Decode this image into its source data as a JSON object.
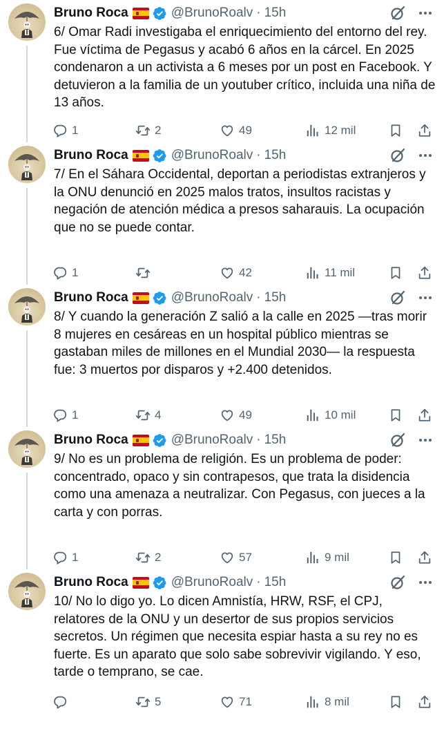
{
  "colors": {
    "text": "#0f1419",
    "secondary": "#536471",
    "verified": "#1d9bf0",
    "thread_line": "#cfd9de"
  },
  "icons": {
    "verified": "verified-badge-icon",
    "grok": "grok-icon",
    "more": "more-icon",
    "reply": "reply-icon",
    "repost": "repost-icon",
    "like": "like-icon",
    "views": "views-icon",
    "bookmark": "bookmark-icon",
    "share": "share-icon"
  },
  "tweets": [
    {
      "author_name": "Bruno Roca",
      "handle": "@BrunoRoalv",
      "dot": "·",
      "time": "15h",
      "text": "6/ Omar Radi investigaba el enriquecimiento del entorno del rey. Fue víctima de Pegasus y acabó 6 años en la cárcel. En 2025 condenaron a un activista a 6 meses por un post en Facebook. Y detuvieron a la familia de un youtuber crítico, incluida una niña de 13 años.",
      "replies": "1",
      "reposts": "2",
      "likes": "49",
      "views": "12 mil"
    },
    {
      "author_name": "Bruno Roca",
      "handle": "@BrunoRoalv",
      "dot": "·",
      "time": "15h",
      "text": "7/ En el Sáhara Occidental, deportan a periodistas extranjeros y la ONU denunció en 2025 malos tratos, insultos racistas y negación de atención médica a presos saharauis. La ocupación que no se puede contar.",
      "replies": "1",
      "reposts": "",
      "likes": "42",
      "views": "11 mil"
    },
    {
      "author_name": "Bruno Roca",
      "handle": "@BrunoRoalv",
      "dot": "·",
      "time": "15h",
      "text": "8/ Y cuando la generación Z salió a la calle en 2025 —tras morir 8 mujeres en cesáreas en un hospital público mientras se gastaban miles de millones en el Mundial 2030— la respuesta fue: 3 muertos por disparos y +2.400 detenidos.",
      "replies": "1",
      "reposts": "4",
      "likes": "49",
      "views": "10 mil"
    },
    {
      "author_name": "Bruno Roca",
      "handle": "@BrunoRoalv",
      "dot": "·",
      "time": "15h",
      "text": "9/ No es un problema de religión. Es un problema de poder: concentrado, opaco y sin contrapesos, que trata la disidencia como una amenaza a neutralizar. Con Pegasus, con jueces a la carta y con porras.",
      "replies": "1",
      "reposts": "2",
      "likes": "57",
      "views": "9 mil"
    },
    {
      "author_name": "Bruno Roca",
      "handle": "@BrunoRoalv",
      "dot": "·",
      "time": "15h",
      "text": "10/ No lo digo yo. Lo dicen Amnistía, HRW, RSF, el CPJ, relatores de la ONU y un desertor de sus propios servicios secretos. Un régimen que necesita espiar hasta a su rey no es fuerte. Es un aparato que solo sabe sobrevivir vigilando. Y eso, tarde o temprano, se cae.",
      "replies": "",
      "reposts": "5",
      "likes": "71",
      "views": "8 mil"
    }
  ]
}
